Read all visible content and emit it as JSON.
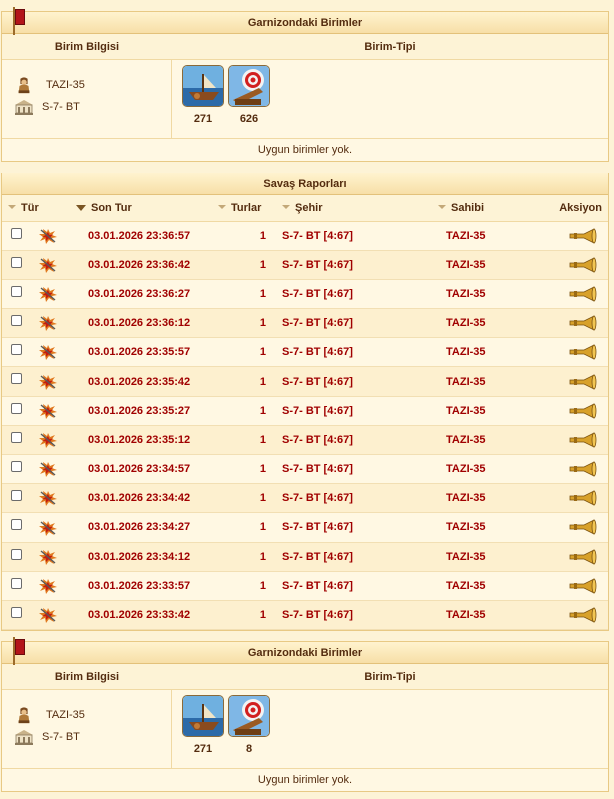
{
  "garrison_top": {
    "title": "Garnizondaki Birimler",
    "col_info": "Birim Bilgisi",
    "col_type": "Birim-Tipi",
    "owner": "TAZI-35",
    "city": "S-7- BT",
    "units": [
      {
        "icon": "ship-unit-icon",
        "count": "271"
      },
      {
        "icon": "ballista-unit-icon",
        "count": "626"
      }
    ],
    "footer": "Uygun birimler yok."
  },
  "reports": {
    "title": "Savaş Raporları",
    "headers": {
      "type": "Tür",
      "last_round": "Son Tur",
      "rounds": "Turlar",
      "city": "Şehir",
      "owner": "Sahibi",
      "action": "Aksiyon"
    },
    "rows": [
      {
        "time": "03.01.2026 23:36:57",
        "rounds": "1",
        "city": "S-7- BT [4:67]",
        "owner": "TAZI-35"
      },
      {
        "time": "03.01.2026 23:36:42",
        "rounds": "1",
        "city": "S-7- BT [4:67]",
        "owner": "TAZI-35"
      },
      {
        "time": "03.01.2026 23:36:27",
        "rounds": "1",
        "city": "S-7- BT [4:67]",
        "owner": "TAZI-35"
      },
      {
        "time": "03.01.2026 23:36:12",
        "rounds": "1",
        "city": "S-7- BT [4:67]",
        "owner": "TAZI-35"
      },
      {
        "time": "03.01.2026 23:35:57",
        "rounds": "1",
        "city": "S-7- BT [4:67]",
        "owner": "TAZI-35"
      },
      {
        "time": "03.01.2026 23:35:42",
        "rounds": "1",
        "city": "S-7- BT [4:67]",
        "owner": "TAZI-35"
      },
      {
        "time": "03.01.2026 23:35:27",
        "rounds": "1",
        "city": "S-7- BT [4:67]",
        "owner": "TAZI-35"
      },
      {
        "time": "03.01.2026 23:35:12",
        "rounds": "1",
        "city": "S-7- BT [4:67]",
        "owner": "TAZI-35"
      },
      {
        "time": "03.01.2026 23:34:57",
        "rounds": "1",
        "city": "S-7- BT [4:67]",
        "owner": "TAZI-35"
      },
      {
        "time": "03.01.2026 23:34:42",
        "rounds": "1",
        "city": "S-7- BT [4:67]",
        "owner": "TAZI-35"
      },
      {
        "time": "03.01.2026 23:34:27",
        "rounds": "1",
        "city": "S-7- BT [4:67]",
        "owner": "TAZI-35"
      },
      {
        "time": "03.01.2026 23:34:12",
        "rounds": "1",
        "city": "S-7- BT [4:67]",
        "owner": "TAZI-35"
      },
      {
        "time": "03.01.2026 23:33:57",
        "rounds": "1",
        "city": "S-7- BT [4:67]",
        "owner": "TAZI-35"
      },
      {
        "time": "03.01.2026 23:33:42",
        "rounds": "1",
        "city": "S-7- BT [4:67]",
        "owner": "TAZI-35"
      }
    ]
  },
  "garrison_bottom": {
    "title": "Garnizondaki Birimler",
    "col_info": "Birim Bilgisi",
    "col_type": "Birim-Tipi",
    "owner": "TAZI-35",
    "city": "S-7- BT",
    "units": [
      {
        "icon": "ship-unit-icon",
        "count": "271"
      },
      {
        "icon": "ballista-unit-icon",
        "count": "8"
      }
    ],
    "footer": "Uygun birimler yok."
  },
  "colors": {
    "accent_red": "#a00000",
    "text_brown": "#542c0f",
    "background": "#fdf3d6"
  }
}
